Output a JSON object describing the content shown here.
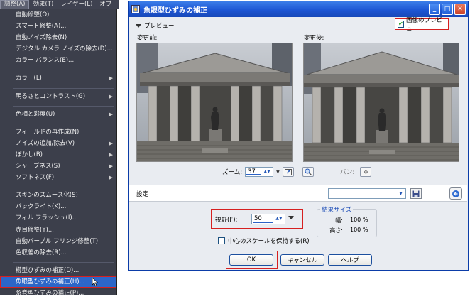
{
  "menubar": {
    "items": [
      {
        "label": "調整(A)",
        "active": true
      },
      {
        "label": "効果(T)"
      },
      {
        "label": "レイヤー(L)"
      },
      {
        "label": "オブ"
      }
    ]
  },
  "menu": {
    "items": [
      {
        "label": "自動修整(O)"
      },
      {
        "label": "スマート修整(A)..."
      },
      {
        "label": "自動ノイズ除去(N)"
      },
      {
        "label": "デジタル カメラ ノイズの除去(D)..."
      },
      {
        "label": "カラー バランス(E)..."
      },
      {
        "sep": true
      },
      {
        "label": "カラー(L)",
        "submenu": true
      },
      {
        "sep": true
      },
      {
        "label": "明るさとコントラスト(G)",
        "submenu": true
      },
      {
        "sep": true
      },
      {
        "label": "色相と彩度(U)",
        "submenu": true
      },
      {
        "sep": true
      },
      {
        "label": "フィールドの再作成(N)"
      },
      {
        "label": "ノイズの追加/除去(V)",
        "submenu": true
      },
      {
        "label": "ぼかし(B)",
        "submenu": true
      },
      {
        "label": "シャープネス(S)",
        "submenu": true
      },
      {
        "label": "ソフトネス(F)",
        "submenu": true
      },
      {
        "sep": true
      },
      {
        "label": "スキンのスムース化(S)"
      },
      {
        "label": "バックライト(K)..."
      },
      {
        "label": "フィル フラッシュ(I)..."
      },
      {
        "label": "赤目修整(Y)..."
      },
      {
        "label": "自動パープル フリンジ修整(T)"
      },
      {
        "label": "色収差の除去(R)..."
      },
      {
        "sep": true
      },
      {
        "label": "樽型ひずみの補正(D)..."
      },
      {
        "label": "魚眼型ひずみの補正(H)...",
        "highlight": true
      },
      {
        "label": "糸巻型ひずみの補正(P)..."
      }
    ]
  },
  "dialog": {
    "title": "魚眼型ひずみの補正",
    "preview_toggle": "プレビュー",
    "show_preview_label": "画像のプレビュー",
    "before_label": "変更前:",
    "after_label": "変更後:",
    "zoom_label": "ズーム:",
    "zoom_value": "37",
    "pan_label": "パン:",
    "settings_label": "設定",
    "fov_label": "視野(F):",
    "fov_value": "50",
    "result_title": "結果サイズ",
    "width_label": "幅:",
    "width_value": "100 %",
    "height_label": "高さ:",
    "height_value": "100 %",
    "keep_scale_label": "中心のスケールを保持する(R)",
    "ok_label": "OK",
    "cancel_label": "キャンセル",
    "help_label": "ヘルプ"
  },
  "colors": {
    "menu_bg": "#3c3f4b",
    "highlight": "#2c66c8",
    "annotation_red": "#d62020",
    "titlebar": "#1d56d4"
  }
}
